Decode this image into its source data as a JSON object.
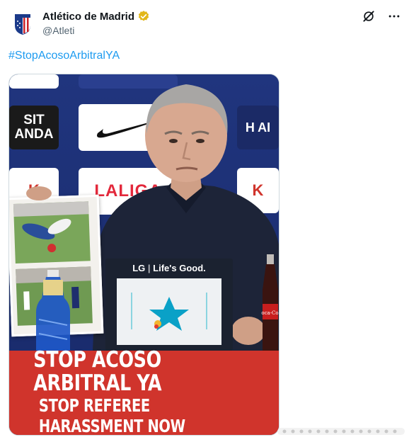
{
  "account": {
    "name": "Atlético de Madrid",
    "handle": "@Atleti"
  },
  "tweet": {
    "hashtag": "#StopAcosoArbitralYA"
  },
  "image": {
    "sponsor_partial_1": "SIT",
    "sponsor_partial_2": "ANDA",
    "sponsor_partial_3": "H AI",
    "sponsor_laliga": "LALIGA",
    "lg_brand": "LG",
    "lg_tagline": "Life's Good.",
    "bottle_brand": "Coca-Cola",
    "banner_line1": "STOP ACOSO ARBITRAL YA",
    "banner_line2": "STOP REFEREE HARASSMENT NOW"
  },
  "icons": {
    "verified": "verified-gold-badge",
    "grok": "grok-icon",
    "more": "more-icon"
  },
  "colors": {
    "hashtag": "#1d9bf0",
    "banner": "#d0342c",
    "verified": "#e2b719",
    "backdrop": "#20357e"
  }
}
